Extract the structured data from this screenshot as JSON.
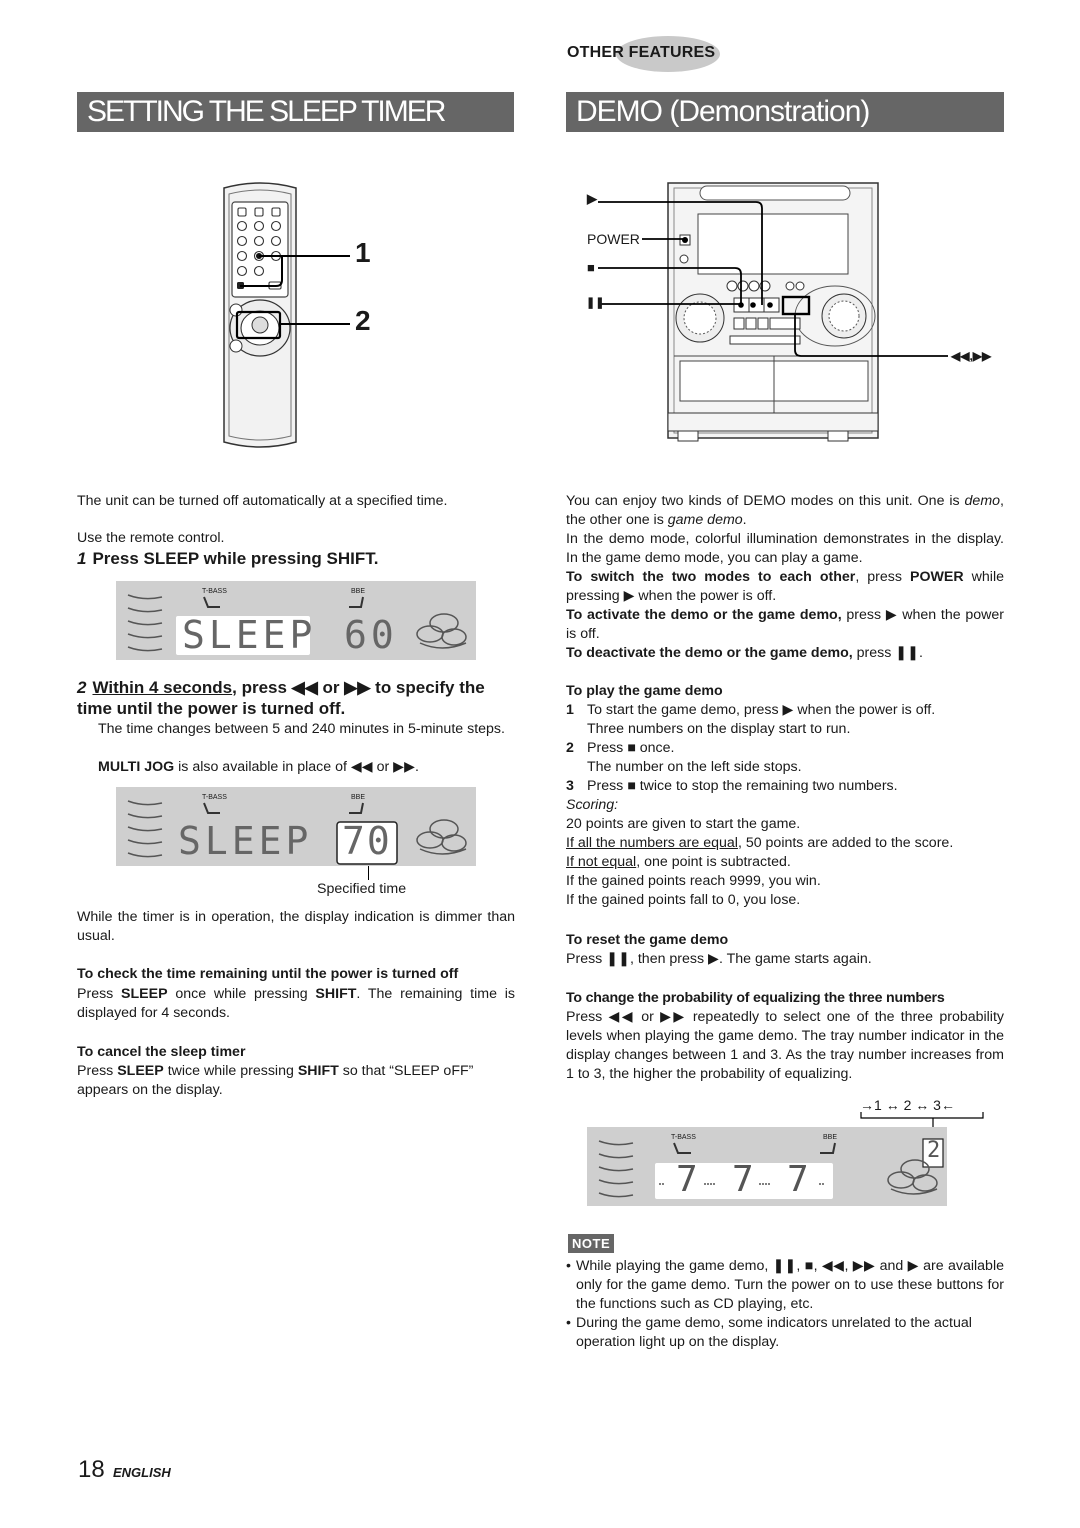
{
  "header": {
    "section_label": "OTHER FEATURES",
    "left_title": "SETTING THE SLEEP TIMER",
    "right_title": "DEMO (Demonstration)"
  },
  "sleep": {
    "intro": "The unit can be turned off automatically at a specified time.",
    "use_remote": "Use the remote control.",
    "remote_callouts": [
      "1",
      "2"
    ],
    "step1": {
      "num": "1",
      "text": "Press SLEEP while pressing SHIFT."
    },
    "display1": {
      "tbass": "T-BASS",
      "bbe": "BBE",
      "text": "SLEEP",
      "value": "60"
    },
    "step2": {
      "num": "2",
      "underlined": "Within 4 seconds",
      "text_a": ", press ",
      "rew": "◀◀",
      "or": " or ",
      "ff": "▶▶",
      "text_b": " to specify the time until the power is turned off.",
      "detail1": "The time changes between 5 and 240 minutes in 5-minute steps.",
      "detail2_bold": "MULTI JOG",
      "detail2_rest": " is also available in place of ◀◀ or ▶▶."
    },
    "display2": {
      "tbass": "T-BASS",
      "bbe": "BBE",
      "text": "SLEEP",
      "value": "70",
      "caption": "Specified time"
    },
    "dimmer_note": "While the timer is in operation, the display indication is dimmer than usual.",
    "check": {
      "heading": "To check the time remaining until the power is turned off",
      "p1": "Press ",
      "b1": "SLEEP",
      "p2": " once while pressing ",
      "b2": "SHIFT",
      "p3": ".  The remaining time is displayed for 4 seconds."
    },
    "cancel": {
      "heading": "To cancel the sleep timer",
      "p1": "Press ",
      "b1": "SLEEP",
      "p2": " twice while pressing ",
      "b2": "SHIFT",
      "p3": "  so that “SLEEP oFF” appears on the display."
    }
  },
  "demo": {
    "diagram_labels": {
      "play": "▶",
      "power": "POWER",
      "stop": "■",
      "pause": "❚❚",
      "skip": "◀◀,▶▶"
    },
    "intro1_a": "You can enjoy two kinds of DEMO modes on this unit. One is ",
    "intro1_i1": "demo",
    "intro1_b": ", the other one is ",
    "intro1_i2": "game demo",
    "intro1_c": ".",
    "intro2": "In the demo mode, colorful illumination demonstrates in the display. In the game demo mode, you can play a game.",
    "switch_bold": "To switch the two modes to each other",
    "switch_a": ", press ",
    "switch_power": "POWER",
    "switch_b": " while pressing ▶ when the power is off.",
    "activate_bold": "To activate the demo or the game demo,",
    "activate_rest": " press ▶ when the power is off.",
    "deactivate_bold": "To deactivate the demo or the game demo,",
    "deactivate_rest": " press ❚❚.",
    "play": {
      "heading": "To play the game demo",
      "steps": [
        {
          "n": "1",
          "text": "To start the game demo, press ▶ when the power is off.",
          "sub": "Three numbers on the display start to run."
        },
        {
          "n": "2",
          "text": "Press ■ once.",
          "sub": "The number on the left side stops."
        },
        {
          "n": "3",
          "text": "Press ■ twice to stop the remaining two numbers.",
          "sub": ""
        }
      ],
      "scoring_label": "Scoring:",
      "score1": "20 points are given to start the game.",
      "score2_u": "If all the numbers are equal",
      "score2_rest": ", 50 points are added to the score.",
      "score3_u": "If not equal",
      "score3_rest": ", one point is subtracted.",
      "score4": "If the gained points reach 9999, you win.",
      "score5": "If the gained points fall to 0, you lose."
    },
    "reset": {
      "heading": "To reset the game demo",
      "text": "Press ❚❚, then press  ▶.  The game starts again."
    },
    "probability": {
      "heading": "To change the probability of equalizing the three numbers",
      "text": "Press ◀◀ or ▶▶ repeatedly to select one of the three probability levels when playing the game demo. The tray number indicator in the display changes between 1 and 3. As the tray number increases from 1 to 3, the higher the probability of equalizing."
    },
    "display3": {
      "tbass": "T-BASS",
      "bbe": "BBE",
      "digits": [
        "7",
        "7",
        "7"
      ],
      "tray": "2",
      "cycle": [
        "1",
        "2",
        "3"
      ]
    },
    "note": {
      "badge": "NOTE",
      "bullets": [
        "While playing the game demo, ❚❚, ■, ◀◀, ▶▶ and ▶ are available only for the game demo. Turn the power on to use these buttons for the functions such as CD playing, etc.",
        "During the game demo, some indicators unrelated to the actual operation light up on the display."
      ]
    }
  },
  "footer": {
    "page": "18",
    "language": "ENGLISH"
  }
}
